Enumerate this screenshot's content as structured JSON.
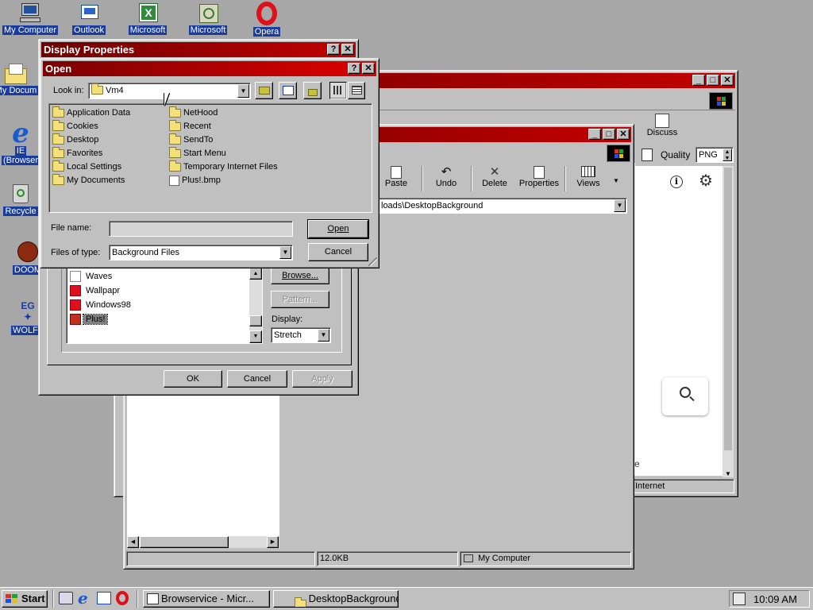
{
  "desktop": {
    "icons": [
      {
        "label": "My Computer",
        "icon": "computer-icon"
      },
      {
        "label": "Outlook",
        "icon": "outlook-icon"
      },
      {
        "label": "Microsoft",
        "icon": "excel-icon"
      },
      {
        "label": "Microsoft",
        "icon": "project-icon"
      },
      {
        "label": "Opera",
        "icon": "opera-icon"
      },
      {
        "label": "My Docum",
        "icon": "my-documents-icon"
      },
      {
        "label": "IE",
        "label2": "(Browser",
        "icon": "ie-icon"
      },
      {
        "label": "Recycle",
        "icon": "recycle-bin-icon"
      },
      {
        "label": "DOOM",
        "icon": "doom-icon"
      },
      {
        "label": "WOLF3",
        "icon": "wolf3d-icon"
      }
    ]
  },
  "browser_back": {
    "toolbar": {
      "discuss_label": "Discuss"
    },
    "status": {
      "zone": "Internet",
      "partial": "e"
    }
  },
  "explorer": {
    "quality_label": "Quality",
    "quality_value": "PNG",
    "toolbar": {
      "paste": "Paste",
      "undo": "Undo",
      "delete": "Delete",
      "properties": "Properties",
      "views": "Views"
    },
    "address": "loads\\DesktopBackground",
    "status": {
      "size": "12.0KB",
      "zone": "My Computer"
    }
  },
  "display_properties": {
    "title": "Display Properties",
    "wallpaper_list": [
      "Waves",
      "Wallpapr",
      "Windows98",
      "Plus!"
    ],
    "browse_label": "Browse...",
    "pattern_label": "Pattern...",
    "display_label": "Display:",
    "display_value": "Stretch",
    "ok_label": "OK",
    "cancel_label": "Cancel",
    "apply_label": "Apply"
  },
  "open_dialog": {
    "title": "Open",
    "look_in_label": "Look in:",
    "look_in_value": "Vm4",
    "files_col1": [
      "Application Data",
      "Cookies",
      "Desktop",
      "Favorites",
      "Local Settings",
      "My Documents"
    ],
    "files_col2": [
      "NetHood",
      "Recent",
      "SendTo",
      "Start Menu",
      "Temporary Internet Files",
      "Plus!.bmp"
    ],
    "file_name_label": "File name:",
    "file_name_value": "",
    "files_of_type_label": "Files of type:",
    "files_of_type_value": "Background Files",
    "open_label": "Open",
    "cancel_label": "Cancel"
  },
  "taskbar": {
    "start_label": "Start",
    "tasks": [
      {
        "label": "Browservice - Micr..."
      },
      {
        "label": "DesktopBackground"
      }
    ],
    "clock": "10:09 AM"
  },
  "colors": {
    "title_active": "#e00000",
    "title_dark": "#7a0000",
    "desktop": "#a7a7a7",
    "selection": "#1a3c9e"
  }
}
